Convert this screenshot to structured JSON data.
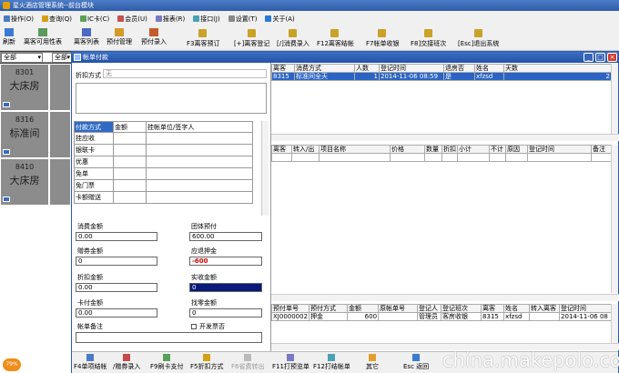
{
  "app": {
    "title": "星火酒店管理系统--前台模块"
  },
  "menu": [
    "操作(O)",
    "查询(Q)",
    "IC卡(C)",
    "会员(U)",
    "报表(R)",
    "接口(J)",
    "设置(T)",
    "关于(A)"
  ],
  "toolbar": {
    "left": [
      "刷新",
      "离客可用性表",
      "离客列表",
      "预付管理",
      "预付录入"
    ],
    "right": [
      "F3离客预订",
      "[+]离客登记",
      "[/]消费录入",
      "F12离客结帐",
      "F7帐单收银",
      "F8]交接班次",
      "[Esc]退出系统"
    ]
  },
  "filter": {
    "a": "全部",
    "b": "全部"
  },
  "rooms": [
    {
      "no": "8301",
      "type": "大床房"
    },
    {
      "no": "8316",
      "type": "标准间"
    },
    {
      "no": "8410",
      "type": "大床房"
    }
  ],
  "dialog": {
    "title": "帐单付款",
    "discount_label": "折扣方式",
    "discount_value": "无",
    "pay_headers": [
      "付款方式",
      "金额",
      "挂帐单位/签字人"
    ],
    "pay_methods": [
      "挂应收",
      "银联卡",
      "优惠",
      "免单",
      "免门票",
      "卡额赠送"
    ],
    "fields": {
      "consume_label": "消费金额",
      "consume": "0.00",
      "group_label": "团体预付",
      "group": "600.00",
      "voucher_label": "赠券金额",
      "voucher": "0",
      "refund_label": "应退押金",
      "refund": "-600",
      "discount_amt_label": "折扣金额",
      "discount_amt": "0.00",
      "received_label": "实收金额",
      "received": "0",
      "card_label": "卡付金额",
      "card": "0.00",
      "change_label": "找零金额",
      "change": "0",
      "remark_label": "帐单备注",
      "invoice_label": "开发票否"
    },
    "top_table": {
      "headers": [
        "离客",
        "消费方式",
        "人数",
        "登记时间",
        "退房否",
        "姓名",
        "天数"
      ],
      "rows": [
        [
          "8315",
          "标准间全天",
          "1",
          "2014-11-06 08:59",
          "是",
          "xfzsd",
          "2"
        ]
      ]
    },
    "mid_table": {
      "headers": [
        "离客",
        "转入/出",
        "项目名称",
        "价格",
        "数量",
        "折扣",
        "小计",
        "不计",
        "原因",
        "登记时间",
        "备注"
      ]
    },
    "bot_table": {
      "headers": [
        "预付单号",
        "预付方式",
        "金额",
        "原帐单号",
        "登记人",
        "登记班次",
        "离客",
        "姓名",
        "转入离客",
        "登记时间"
      ],
      "rows": [
        [
          "XJ0000002",
          "押金",
          "600",
          "",
          "管理员",
          "客房收银",
          "8315",
          "xfzsd",
          "",
          "2014-11-06 08"
        ]
      ]
    },
    "bottom_buttons": [
      "F4单项结帐",
      "/赠券录入",
      "F9刷卡支付",
      "F5折扣方式",
      "F6省费转出",
      "F11打预览单",
      "F12打结帐单",
      "其它",
      "Esc 返回"
    ]
  },
  "watermark": "china.makepolo.com",
  "progress_badge": "79%"
}
